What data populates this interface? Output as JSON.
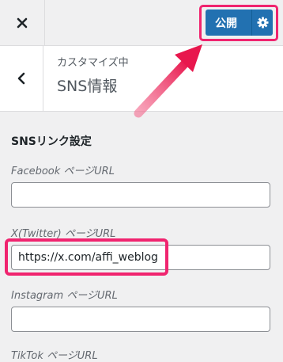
{
  "topbar": {
    "close_icon": "close-icon",
    "publish_label": "公開",
    "settings_icon": "gear-icon",
    "accent_color": "#2271b1",
    "highlight_color": "#f0246f"
  },
  "section": {
    "back_icon": "chevron-left-icon",
    "breadcrumb": "カスタマイズ中",
    "title": "SNS情報"
  },
  "sns_settings": {
    "group_title": "SNSリンク設定",
    "fields": [
      {
        "label": "Facebook ページURL",
        "value": ""
      },
      {
        "label": "X(Twitter) ページURL",
        "value": "https://x.com/affi_weblog"
      },
      {
        "label": "Instagram ページURL",
        "value": ""
      },
      {
        "label": "TikTok ページURL",
        "value": ""
      }
    ]
  }
}
